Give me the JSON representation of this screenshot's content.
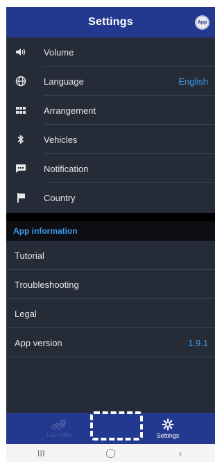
{
  "header": {
    "title": "Settings",
    "badge_text": "App"
  },
  "settings": [
    {
      "label": "Volume",
      "value": "",
      "icon": "volume-icon"
    },
    {
      "label": "Language",
      "value": "English",
      "icon": "globe-icon"
    },
    {
      "label": "Arrangement",
      "value": "",
      "icon": "grid-icon"
    },
    {
      "label": "Vehicles",
      "value": "",
      "icon": "bluetooth-icon"
    },
    {
      "label": "Notification",
      "value": "",
      "icon": "message-icon"
    },
    {
      "label": "Country",
      "value": "",
      "icon": "flag-icon"
    }
  ],
  "app_info": {
    "heading": "App information",
    "items": [
      {
        "label": "Tutorial",
        "value": ""
      },
      {
        "label": "Troubleshooting",
        "value": ""
      },
      {
        "label": "Legal",
        "value": ""
      },
      {
        "label": "App version",
        "value": "1.9.1"
      }
    ]
  },
  "bottom_nav": {
    "last_mile": "Last Mile",
    "settings": "Settings"
  },
  "system_nav": {
    "recents": "III",
    "home": "◯",
    "back": "‹"
  },
  "colors": {
    "header_bg": "#23388f",
    "list_bg": "#262b38",
    "accent": "#3f9be6"
  }
}
